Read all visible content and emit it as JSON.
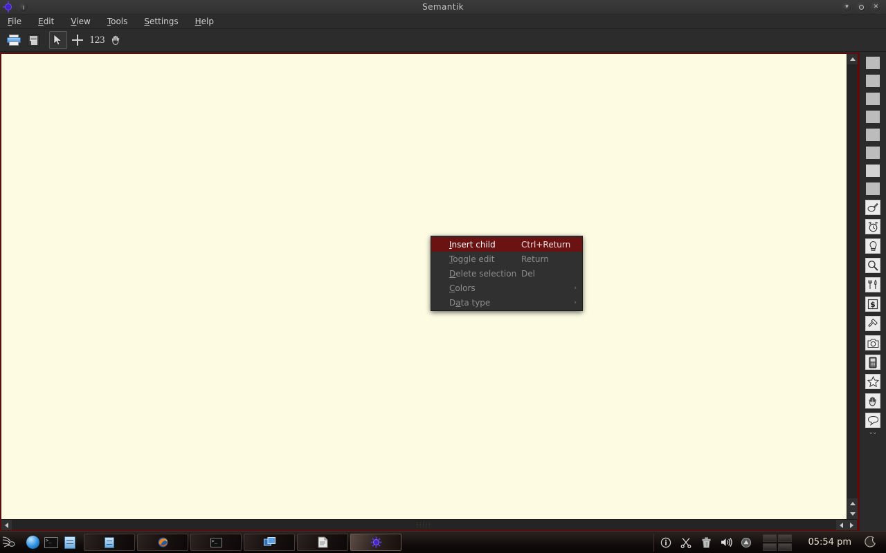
{
  "window": {
    "title": "Semantik",
    "app_icon": "sun-bulb-icon",
    "shade_button": "window-shade-button",
    "buttons": [
      {
        "name": "minimize-button",
        "glyph": "▾"
      },
      {
        "name": "maximize-button",
        "glyph": ""
      },
      {
        "name": "close-button",
        "glyph": "✕"
      }
    ]
  },
  "menubar": {
    "items": [
      {
        "name": "menu-file",
        "label": "File",
        "accel": "F"
      },
      {
        "name": "menu-edit",
        "label": "Edit",
        "accel": "E"
      },
      {
        "name": "menu-view",
        "label": "View",
        "accel": "V"
      },
      {
        "name": "menu-tools",
        "label": "Tools",
        "accel": "T"
      },
      {
        "name": "menu-settings",
        "label": "Settings",
        "accel": "S"
      },
      {
        "name": "menu-help",
        "label": "Help",
        "accel": "H"
      }
    ]
  },
  "toolbar": {
    "items": [
      {
        "name": "open-button",
        "icon": "open-folder-icon",
        "active": false
      },
      {
        "name": "save-button",
        "icon": "floppy-save-icon",
        "active": false
      },
      {
        "name": "select-tool-button",
        "icon": "cursor-arrow-icon",
        "active": true
      },
      {
        "name": "insert-tool-button",
        "icon": "plus-icon",
        "active": false
      },
      {
        "name": "numbering-tool-button",
        "icon": "123-number-icon",
        "active": false,
        "label": "123"
      },
      {
        "name": "pan-tool-button",
        "icon": "hand-icon",
        "active": false
      }
    ]
  },
  "canvas": {
    "background_color": "#fdfce3",
    "border_color": "#5a0d0d"
  },
  "context_menu": {
    "items": [
      {
        "name": "ctx-insert-child",
        "label": "Insert child",
        "accel": "I",
        "shortcut": "Ctrl+Return",
        "highlighted": true,
        "submenu": false,
        "enabled": true
      },
      {
        "name": "ctx-toggle-edit",
        "label": "Toggle edit",
        "accel": "T",
        "shortcut": "Return",
        "highlighted": false,
        "submenu": false,
        "enabled": false
      },
      {
        "name": "ctx-delete-selection",
        "label": "Delete selection",
        "accel": "D",
        "shortcut": "Del",
        "highlighted": false,
        "submenu": false,
        "enabled": false
      },
      {
        "name": "ctx-colors",
        "label": "Colors",
        "accel": "C",
        "shortcut": "",
        "highlighted": false,
        "submenu": true,
        "enabled": false
      },
      {
        "name": "ctx-data-type",
        "label": "Data type",
        "accel": "a",
        "shortcut": "",
        "highlighted": false,
        "submenu": true,
        "enabled": false
      }
    ],
    "highlight_color": "#6b1212",
    "submenu_arrow": "›"
  },
  "palette": {
    "swatches": [
      {
        "name": "palette-swatch-1",
        "color": "#bcbcbc"
      },
      {
        "name": "palette-swatch-2",
        "color": "#c0c0c0"
      },
      {
        "name": "palette-swatch-3",
        "color": "#b8b8b8"
      },
      {
        "name": "palette-swatch-4",
        "color": "#bdbdbd"
      },
      {
        "name": "palette-swatch-5",
        "color": "#b9b9b9"
      },
      {
        "name": "palette-swatch-6",
        "color": "#c2c2c2"
      },
      {
        "name": "palette-swatch-7",
        "color": "#d2d2d2"
      },
      {
        "name": "palette-swatch-8",
        "color": "#bcbcbc"
      }
    ],
    "icons": [
      {
        "name": "palette-paint-icon",
        "icon": "paint-roller-icon"
      },
      {
        "name": "palette-alarm-icon",
        "icon": "alarm-clock-icon"
      },
      {
        "name": "palette-bulb-icon",
        "icon": "lightbulb-icon"
      },
      {
        "name": "palette-search-icon",
        "icon": "magnifier-icon"
      },
      {
        "name": "palette-food-icon",
        "icon": "fork-knife-icon"
      },
      {
        "name": "palette-money-icon",
        "icon": "dollar-sign-icon",
        "label": "$"
      },
      {
        "name": "palette-gavel-icon",
        "icon": "gavel-icon"
      },
      {
        "name": "palette-camera-icon",
        "icon": "camera-icon"
      },
      {
        "name": "palette-phone-icon",
        "icon": "mobile-phone-icon"
      },
      {
        "name": "palette-star-icon",
        "icon": "star-icon"
      },
      {
        "name": "palette-hand-icon",
        "icon": "hand-icon"
      },
      {
        "name": "palette-cloud-icon",
        "icon": "speech-bubble-icon"
      }
    ],
    "overflow_glyph": "˅˅"
  },
  "scrollbars": {
    "vertical": {
      "name": "canvas-vertical-scrollbar",
      "up": "▲",
      "down": "▼"
    },
    "horizontal": {
      "name": "canvas-horizontal-scrollbar",
      "left": "◀",
      "right": "▶"
    }
  },
  "taskbar": {
    "kmenu": {
      "name": "k-menu-button",
      "icon": "spider-menu-icon"
    },
    "launchers": [
      {
        "name": "launcher-browser",
        "icon": "blue-globe-icon"
      },
      {
        "name": "launcher-terminal",
        "icon": "terminal-icon",
        "label": ">_"
      },
      {
        "name": "launcher-file-manager",
        "icon": "file-cabinet-icon"
      }
    ],
    "tasks": [
      {
        "name": "task-file-manager",
        "icon": "file-cabinet-icon",
        "active": false
      },
      {
        "name": "task-firefox",
        "icon": "firefox-icon",
        "active": false
      },
      {
        "name": "task-terminal",
        "icon": "terminal-icon",
        "active": false
      },
      {
        "name": "task-windows",
        "icon": "windows-icon",
        "active": false
      },
      {
        "name": "task-editor",
        "icon": "document-icon",
        "active": false
      },
      {
        "name": "task-semantik",
        "icon": "sun-bulb-icon",
        "active": true
      }
    ],
    "tray": [
      {
        "name": "tray-info-icon",
        "icon": "info-icon",
        "glyph": "ⓘ"
      },
      {
        "name": "tray-klipper-icon",
        "icon": "scissors-icon",
        "glyph": "✂"
      },
      {
        "name": "tray-trash-icon",
        "icon": "trash-icon",
        "glyph": "🗑"
      },
      {
        "name": "tray-volume-icon",
        "icon": "speaker-icon",
        "glyph": "🔊"
      },
      {
        "name": "tray-eject-icon",
        "icon": "eject-icon",
        "glyph": "▲"
      }
    ],
    "pager": {
      "name": "desktop-pager",
      "desktops": 4
    },
    "clock": "05:54 pm",
    "moon": {
      "name": "moon-icon"
    }
  }
}
